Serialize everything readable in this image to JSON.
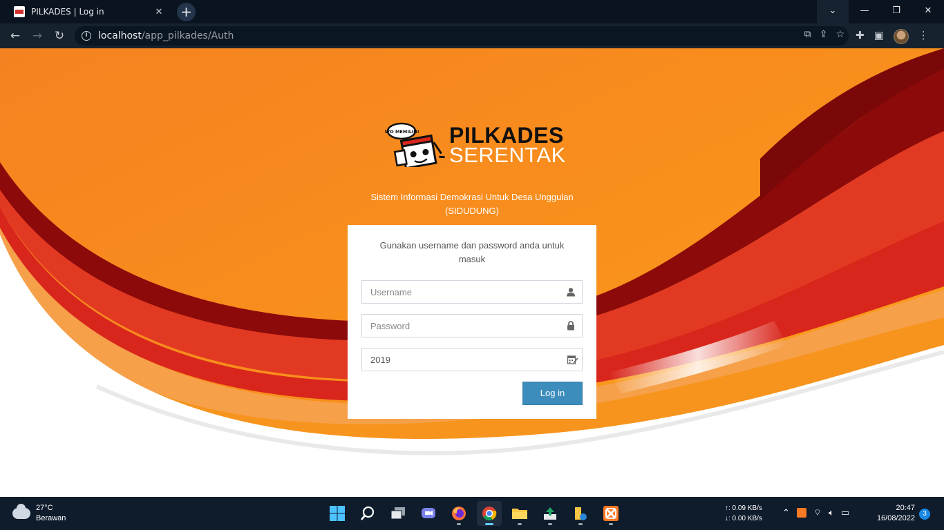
{
  "browser": {
    "tab_title": "PILKADES | Log in",
    "tab_close": "✕",
    "new_tab": "+",
    "url_host": "localhost",
    "url_path": "/app_pilkades/Auth"
  },
  "window_controls": {
    "dropdown": "⌄",
    "minimize": "—",
    "restore": "❐",
    "close": "✕"
  },
  "brand": {
    "line1": "PILKADES",
    "line2": "SERENTAK",
    "mascot_badge": "AYO MEMILIH!"
  },
  "tagline": {
    "line1": "Sistem Informasi Demokrasi Untuk Desa Unggulan",
    "line2": "(SIDUDUNG)"
  },
  "login": {
    "message_line1": "Gunakan username dan password anda untuk",
    "message_line2": "masuk",
    "username_placeholder": "Username",
    "password_placeholder": "Password",
    "year_value": "2019",
    "submit_label": "Log in"
  },
  "taskbar": {
    "weather_temp": "27°C",
    "weather_desc": "Berawan",
    "net_up": "↑: 0.09 KB/s",
    "net_down": "↓: 0.00 KB/s",
    "time": "20:47",
    "date": "16/08/2022",
    "notification_count": "3"
  },
  "colors": {
    "accent_orange": "#f7941d",
    "dark_red": "#8c0a0a",
    "red": "#d9261c",
    "button_blue": "#3c8dbc",
    "taskbar": "#0e1c2c"
  }
}
